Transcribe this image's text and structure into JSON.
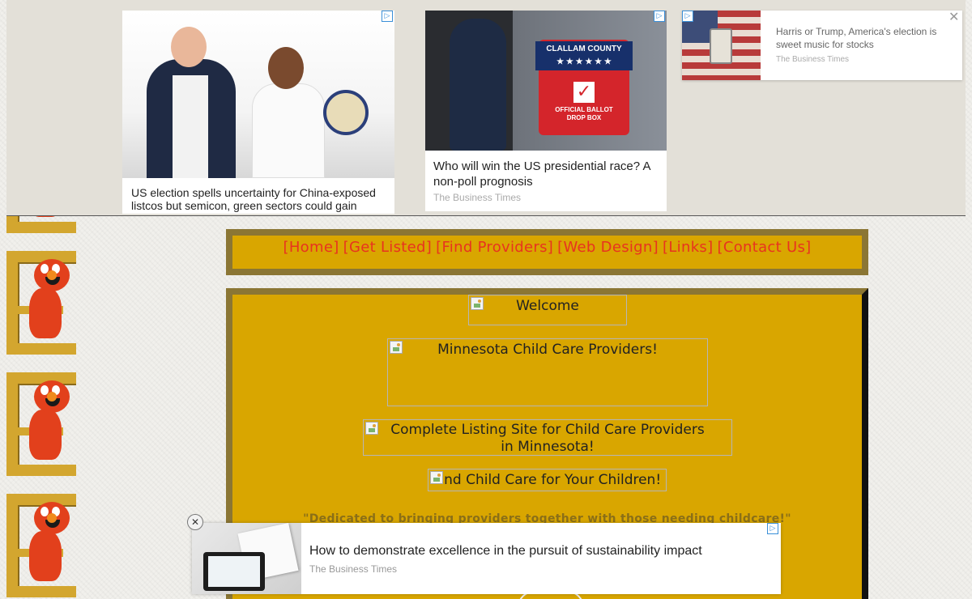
{
  "top_ad": {
    "card1": {
      "headline": "US election spells uncertainty for China-exposed listcos but semicon, green sectors could gain"
    },
    "card2": {
      "headline": "Who will win the US presidential race? A non-poll prognosis",
      "source": "The Business Times",
      "image_text": {
        "county": "CLALLAM COUNTY",
        "stars": "★ ★ ★ ★ ★ ★",
        "check": "✓",
        "box_label": "OFFICIAL BALLOT DROP BOX"
      }
    },
    "card3": {
      "headline": "Harris or Trump, America's election is sweet music for stocks",
      "source": "The Business Times",
      "close": "✕"
    },
    "adchoices_glyph": "▷"
  },
  "nav": {
    "links": [
      "[Home]",
      "[Get Listed]",
      "[Find Providers]",
      "[Web Design]",
      "[Links]",
      "[Contact Us]"
    ]
  },
  "main": {
    "welcome_alt": "Welcome",
    "mn_alt": "Minnesota Child Care Providers!",
    "listing_alt": "Complete Listing Site for Child Care Providers in Minnesota!",
    "find_alt": "Find Child Care for Your Children!",
    "tagline": "\"Dedicated to bringing providers together with those needing childcare!\""
  },
  "bottom_ad": {
    "headline": "How to demonstrate excellence in the pursuit of sustainability impact",
    "source": "The Business Times",
    "close": "✕"
  },
  "colors": {
    "gold": "#d9a600",
    "frame": "#8b7634",
    "nav_link": "#e8331f",
    "tagline": "#8a6f18"
  }
}
